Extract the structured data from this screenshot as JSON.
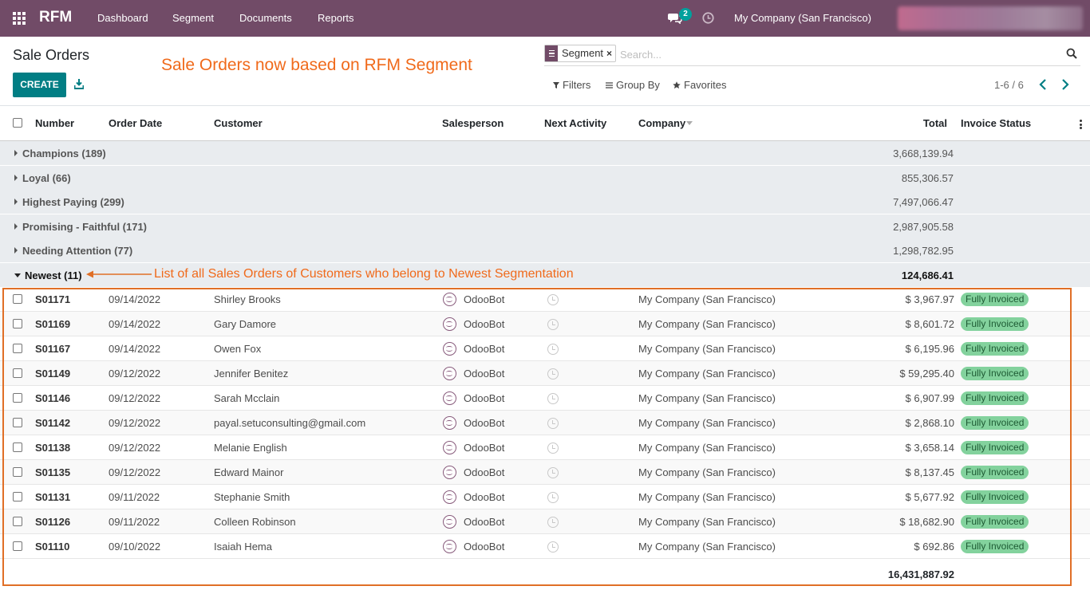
{
  "navbar": {
    "app_name": "RFM",
    "menu": [
      "Dashboard",
      "Segment",
      "Documents",
      "Reports"
    ],
    "messages_count": "2",
    "company": "My Company (San Francisco)",
    "icons": [
      "apps-grid-icon",
      "chat-icon",
      "clock-icon"
    ]
  },
  "control_panel": {
    "title": "Sale Orders",
    "create_label": "CREATE",
    "search": {
      "facet_label": "Segment",
      "facet_close": "×",
      "placeholder": "Search..."
    },
    "filters_label": "Filters",
    "groupby_label": "Group By",
    "favorites_label": "Favorites",
    "pager": "1-6 / 6"
  },
  "annotations": {
    "heading": "Sale Orders now based on RFM Segment",
    "arrow_note": "List of all Sales Orders of Customers who belong to Newest Segmentation"
  },
  "table": {
    "columns": [
      "Number",
      "Order Date",
      "Customer",
      "Salesperson",
      "Next Activity",
      "Company",
      "Total",
      "Invoice Status"
    ],
    "groups": [
      {
        "label": "Champions (189)",
        "total": "3,668,139.94",
        "open": false
      },
      {
        "label": "Loyal (66)",
        "total": "855,306.57",
        "open": false
      },
      {
        "label": "Highest Paying (299)",
        "total": "7,497,066.47",
        "open": false
      },
      {
        "label": "Promising - Faithful (171)",
        "total": "2,987,905.58",
        "open": false
      },
      {
        "label": "Needing Attention (77)",
        "total": "1,298,782.95",
        "open": false
      },
      {
        "label": "Newest (11)",
        "total": "124,686.41",
        "open": true
      }
    ],
    "rows": [
      {
        "number": "S01171",
        "date": "09/14/2022",
        "customer": "Shirley Brooks",
        "salesperson": "OdooBot",
        "company": "My Company (San Francisco)",
        "total": "$ 3,967.97",
        "status": "Fully Invoiced"
      },
      {
        "number": "S01169",
        "date": "09/14/2022",
        "customer": "Gary Damore",
        "salesperson": "OdooBot",
        "company": "My Company (San Francisco)",
        "total": "$ 8,601.72",
        "status": "Fully Invoiced"
      },
      {
        "number": "S01167",
        "date": "09/14/2022",
        "customer": "Owen Fox",
        "salesperson": "OdooBot",
        "company": "My Company (San Francisco)",
        "total": "$ 6,195.96",
        "status": "Fully Invoiced"
      },
      {
        "number": "S01149",
        "date": "09/12/2022",
        "customer": "Jennifer Benitez",
        "salesperson": "OdooBot",
        "company": "My Company (San Francisco)",
        "total": "$ 59,295.40",
        "status": "Fully Invoiced"
      },
      {
        "number": "S01146",
        "date": "09/12/2022",
        "customer": "Sarah Mcclain",
        "salesperson": "OdooBot",
        "company": "My Company (San Francisco)",
        "total": "$ 6,907.99",
        "status": "Fully Invoiced"
      },
      {
        "number": "S01142",
        "date": "09/12/2022",
        "customer": "payal.setuconsulting@gmail.com",
        "salesperson": "OdooBot",
        "company": "My Company (San Francisco)",
        "total": "$ 2,868.10",
        "status": "Fully Invoiced"
      },
      {
        "number": "S01138",
        "date": "09/12/2022",
        "customer": "Melanie English",
        "salesperson": "OdooBot",
        "company": "My Company (San Francisco)",
        "total": "$ 3,658.14",
        "status": "Fully Invoiced"
      },
      {
        "number": "S01135",
        "date": "09/12/2022",
        "customer": "Edward Mainor",
        "salesperson": "OdooBot",
        "company": "My Company (San Francisco)",
        "total": "$ 8,137.45",
        "status": "Fully Invoiced"
      },
      {
        "number": "S01131",
        "date": "09/11/2022",
        "customer": "Stephanie Smith",
        "salesperson": "OdooBot",
        "company": "My Company (San Francisco)",
        "total": "$ 5,677.92",
        "status": "Fully Invoiced"
      },
      {
        "number": "S01126",
        "date": "09/11/2022",
        "customer": "Colleen Robinson",
        "salesperson": "OdooBot",
        "company": "My Company (San Francisco)",
        "total": "$ 18,682.90",
        "status": "Fully Invoiced"
      },
      {
        "number": "S01110",
        "date": "09/10/2022",
        "customer": "Isaiah Hema",
        "salesperson": "OdooBot",
        "company": "My Company (San Francisco)",
        "total": "$ 692.86",
        "status": "Fully Invoiced"
      }
    ],
    "grand_total": "16,431,887.92"
  },
  "colors": {
    "navbar": "#714b67",
    "primary_button": "#017e84",
    "annotation": "#f06a1b",
    "status_badge": "#83d29d"
  }
}
